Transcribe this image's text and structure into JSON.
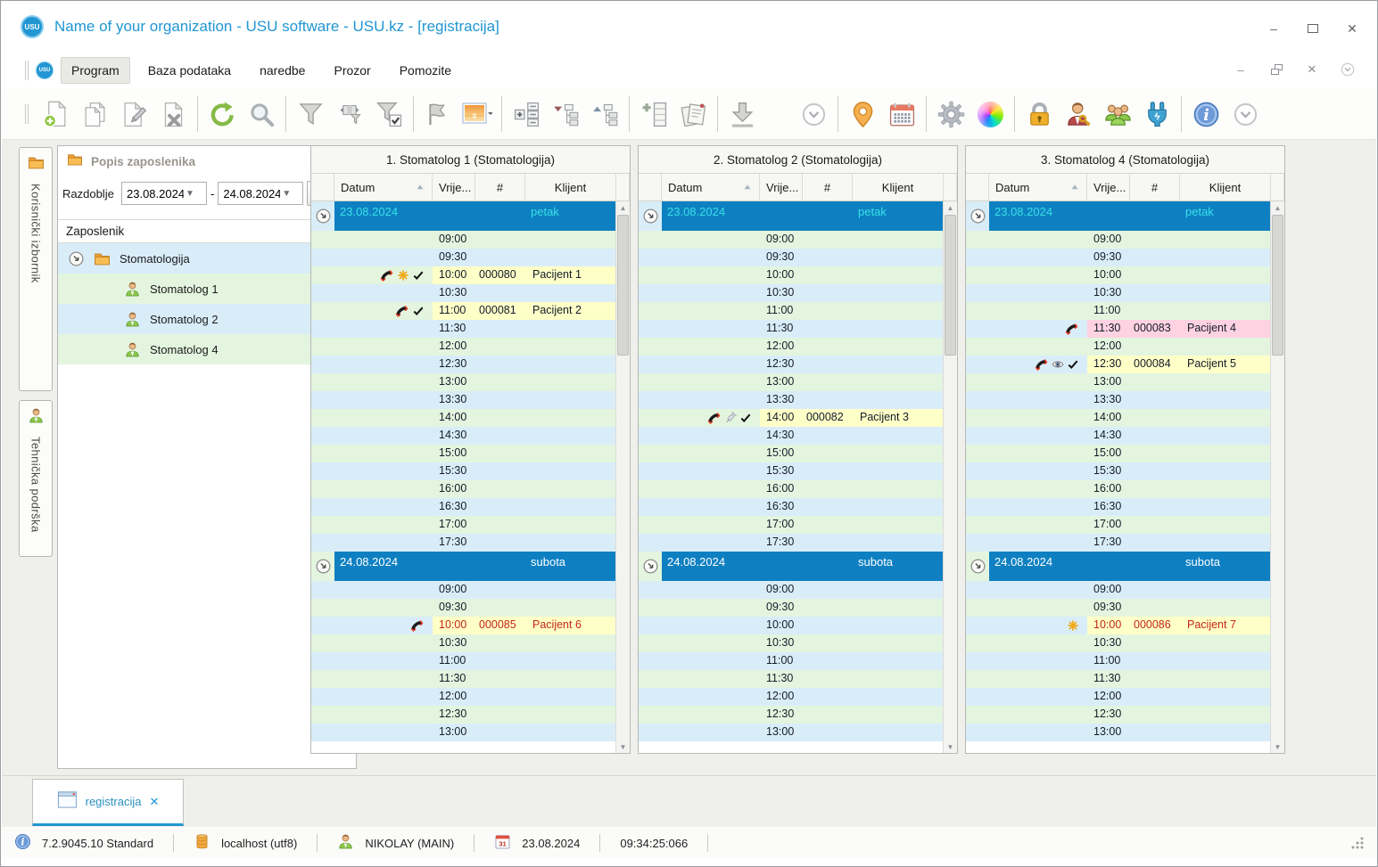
{
  "colors": {
    "accent_blue": "#2196d3",
    "date_band_blue": "#0e80c2",
    "row_green": "#e3f5df",
    "row_blue": "#d9edf9",
    "appointment_yellow": "#ffffc8",
    "appointment_pink": "#ffd2e2",
    "alert_red_text": "#c42818",
    "friday_text_cyan": "#38e0e4",
    "saturday_text_white": "#ffffff"
  },
  "window": {
    "title": "Name of your organization - USU software - USU.kz - [registracija]"
  },
  "menu": {
    "items": [
      "Program",
      "Baza podataka",
      "naredbe",
      "Prozor",
      "Pomozite"
    ],
    "active": "Program"
  },
  "toolbar": {
    "buttons": [
      "new-document",
      "copy-document",
      "edit-document",
      "delete-document",
      "sep",
      "refresh",
      "search",
      "sep",
      "filter",
      "filter-columns",
      "filter-checked",
      "sep",
      "flag",
      "image",
      "sep",
      "expand-groups",
      "expand-tree",
      "collapse-tree",
      "sep",
      "add-column",
      "reports",
      "sep",
      "download",
      "gap",
      "chevron-circle",
      "sep",
      "location-pin",
      "calendar",
      "sep",
      "settings-gear",
      "color-wheel",
      "sep",
      "lock",
      "user-key",
      "users-group",
      "plug",
      "sep",
      "info",
      "chevron-circle"
    ]
  },
  "sidebar": {
    "tabs": [
      {
        "label": "Korisnički izbornik",
        "icon": "folder-icon"
      },
      {
        "label": "Tehnička podrška",
        "icon": "person-icon"
      }
    ],
    "panel_title": "Popis zaposlenika",
    "filter": {
      "label": "Razdoblje",
      "from": "23.08.2024",
      "separator": "-",
      "to": "24.08.2024"
    },
    "tree_header": "Zaposlenik",
    "tree": {
      "root": "Stomatologija",
      "children": [
        "Stomatolog 1",
        "Stomatolog 2",
        "Stomatolog 4"
      ]
    }
  },
  "schedule": {
    "headers": [
      "Datum",
      "Vrije...",
      "#",
      "Klijent"
    ],
    "times_day1": [
      "09:00",
      "09:30",
      "10:00",
      "10:30",
      "11:00",
      "11:30",
      "12:00",
      "12:30",
      "13:00",
      "13:30",
      "14:00",
      "14:30",
      "15:00",
      "15:30",
      "16:00",
      "16:30",
      "17:00",
      "17:30"
    ],
    "times_day2": [
      "09:00",
      "09:30",
      "10:00",
      "10:30",
      "11:00",
      "11:30",
      "12:00",
      "12:30",
      "13:00"
    ],
    "columns": [
      {
        "title": "1. Stomatolog 1 (Stomatologija)",
        "sections": [
          {
            "date": "23.08.2024",
            "day": "petak",
            "day_color": "#38e0e4",
            "appointments": [
              {
                "time": "10:00",
                "number": "000080",
                "client": "Pacijent 1",
                "icons": [
                  "phone",
                  "asterisk",
                  "check"
                ],
                "bg": "#ffffc8",
                "text": "#141c28"
              },
              {
                "time": "11:00",
                "number": "000081",
                "client": "Pacijent 2",
                "icons": [
                  "phone",
                  "check"
                ],
                "bg": "#ffffc8",
                "text": "#141c28"
              }
            ]
          },
          {
            "date": "24.08.2024",
            "day": "subota",
            "day_color": "#ffffff",
            "appointments": [
              {
                "time": "10:00",
                "number": "000085",
                "client": "Pacijent 6",
                "icons": [
                  "phone"
                ],
                "bg": "#ffffc8",
                "text": "#c42818"
              }
            ]
          }
        ]
      },
      {
        "title": "2. Stomatolog 2 (Stomatologija)",
        "sections": [
          {
            "date": "23.08.2024",
            "day": "petak",
            "day_color": "#38e0e4",
            "appointments": [
              {
                "time": "14:00",
                "number": "000082",
                "client": "Pacijent 3",
                "icons": [
                  "phone",
                  "syringe",
                  "check"
                ],
                "bg": "#ffffc8",
                "text": "#141c28"
              }
            ]
          },
          {
            "date": "24.08.2024",
            "day": "subota",
            "day_color": "#ffffff",
            "appointments": []
          }
        ]
      },
      {
        "title": "3. Stomatolog 4 (Stomatologija)",
        "sections": [
          {
            "date": "23.08.2024",
            "day": "petak",
            "day_color": "#38e0e4",
            "appointments": [
              {
                "time": "11:30",
                "number": "000083",
                "client": "Pacijent 4",
                "icons": [
                  "phone"
                ],
                "bg": "#ffd2e2",
                "text": "#141c28"
              },
              {
                "time": "12:30",
                "number": "000084",
                "client": "Pacijent 5",
                "icons": [
                  "phone",
                  "eye",
                  "check"
                ],
                "bg": "#ffffc8",
                "text": "#141c28"
              }
            ]
          },
          {
            "date": "24.08.2024",
            "day": "subota",
            "day_color": "#ffffff",
            "appointments": [
              {
                "time": "10:00",
                "number": "000086",
                "client": "Pacijent 7",
                "icons": [
                  "asterisk"
                ],
                "bg": "#ffffc8",
                "text": "#c42818"
              }
            ]
          }
        ]
      }
    ]
  },
  "footer_tab": {
    "label": "registracija",
    "close_glyph": "✕"
  },
  "statusbar": {
    "version": "7.2.9045.10 Standard",
    "database": "localhost (utf8)",
    "user": "NIKOLAY (MAIN)",
    "date": "23.08.2024",
    "time": "09:34:25:066"
  }
}
